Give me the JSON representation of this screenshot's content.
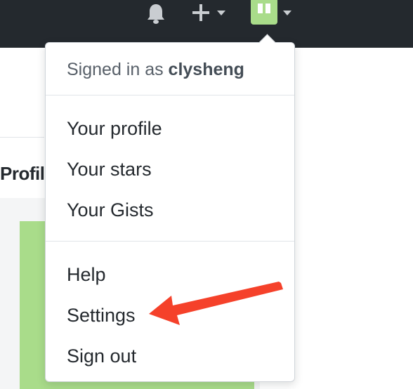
{
  "header": {
    "notifications_icon": "bell-icon",
    "create_icon": "plus-icon",
    "avatar_icon": "avatar-icon",
    "background": "#24292e"
  },
  "page": {
    "profile_heading": "Profil"
  },
  "dropdown": {
    "signed_in_prefix": "Signed in as ",
    "username": "clysheng",
    "items_group1": [
      "Your profile",
      "Your stars",
      "Your Gists"
    ],
    "items_group2": [
      "Help",
      "Settings",
      "Sign out"
    ]
  },
  "annotation": {
    "arrow_color": "#f5412a",
    "points_to": "Settings"
  },
  "colors": {
    "accent_green": "#a9dc8a",
    "text": "#24292e"
  }
}
